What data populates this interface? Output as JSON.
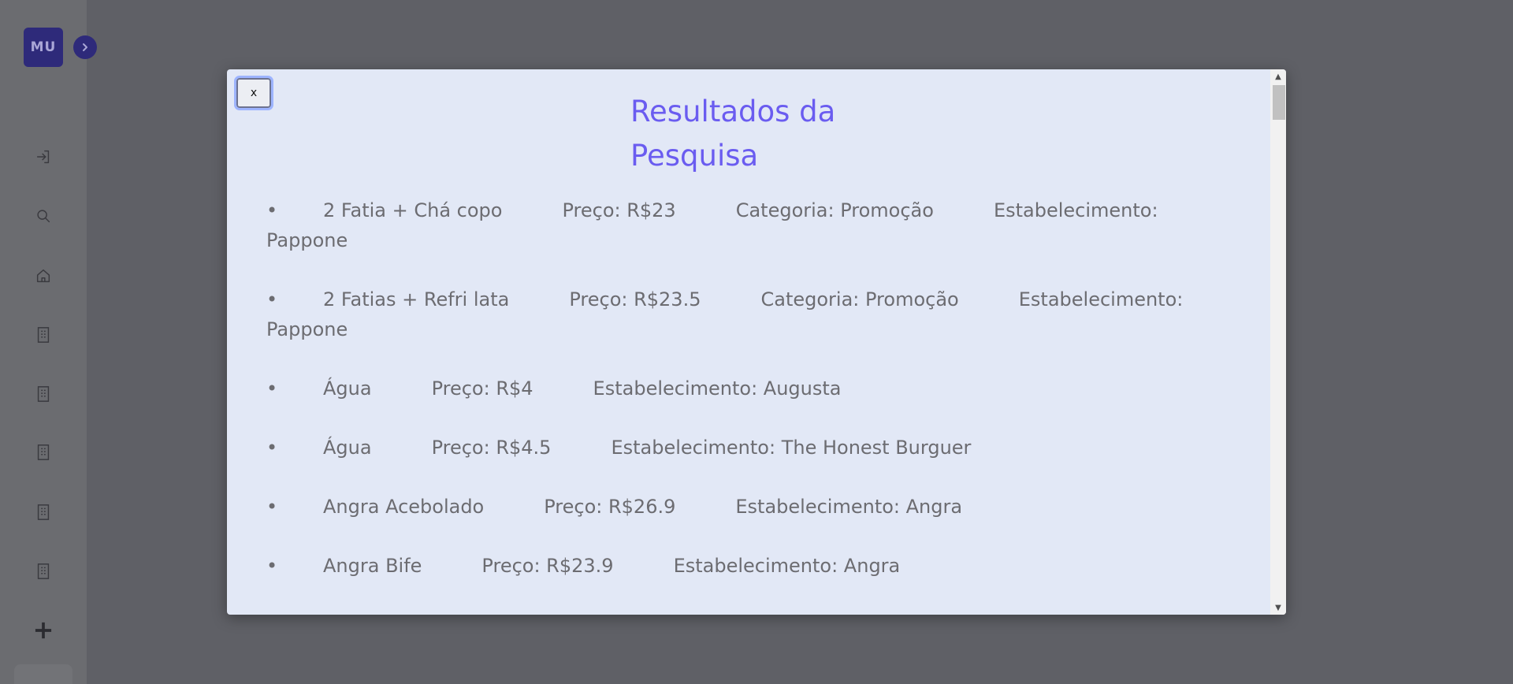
{
  "sidebar": {
    "logo_text": "MU",
    "icons": [
      "login-icon",
      "search-icon",
      "home-icon",
      "building-icon",
      "building-icon",
      "building-icon",
      "building-icon",
      "building-icon",
      "plus-icon"
    ]
  },
  "modal": {
    "close_label": "x",
    "title": "Resultados da Pesquisa",
    "results": [
      {
        "name": "2 Fatia + Chá copo",
        "price": "Preço: R$23",
        "category": "Categoria: Promoção",
        "establishment": "Estabelecimento: Pappone"
      },
      {
        "name": "2 Fatias + Refri lata",
        "price": "Preço: R$23.5",
        "category": "Categoria: Promoção",
        "establishment": "Estabelecimento: Pappone"
      },
      {
        "name": "Água",
        "price": "Preço: R$4",
        "establishment": "Estabelecimento: Augusta"
      },
      {
        "name": "Água",
        "price": "Preço: R$4.5",
        "establishment": "Estabelecimento: The Honest Burguer"
      },
      {
        "name": "Angra Acebolado",
        "price": "Preço: R$26.9",
        "establishment": "Estabelecimento: Angra"
      },
      {
        "name": "Angra Bife",
        "price": "Preço: R$23.9",
        "establishment": "Estabelecimento: Angra"
      }
    ]
  },
  "colors": {
    "overlay_bg": "#5f6066",
    "modal_bg": "#e2e8f6",
    "title": "#6a5cf0",
    "text": "#6c6c71",
    "brand": "#2e2a7a"
  }
}
